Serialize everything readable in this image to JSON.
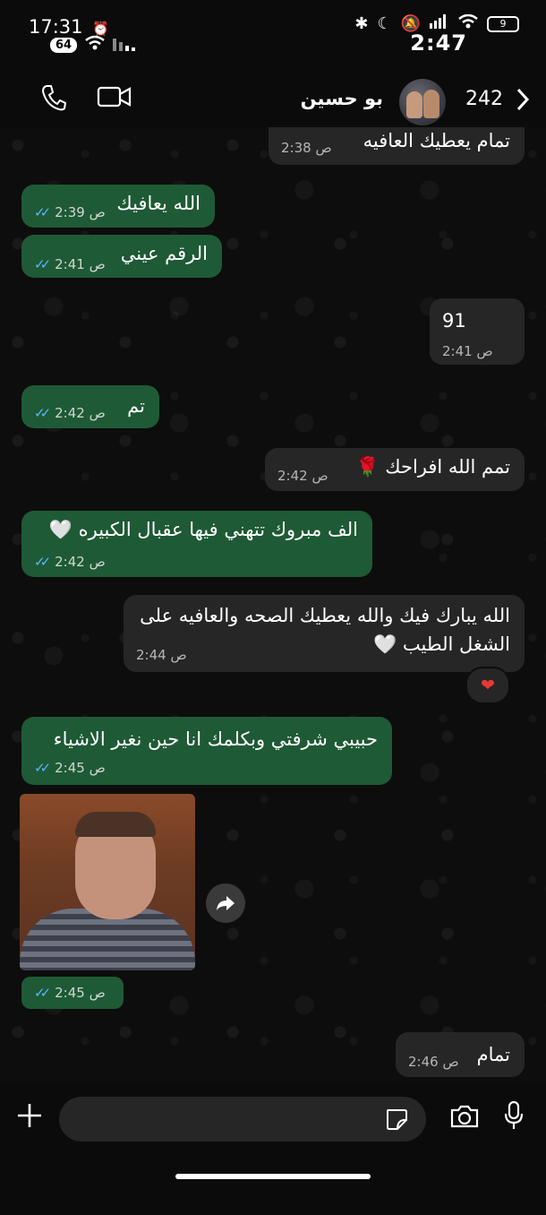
{
  "status_bar": {
    "time_left": "17:31",
    "badge": "64",
    "time_right": "2:47",
    "battery": "9"
  },
  "header": {
    "contact_name": "بو حسين",
    "unread_count": "242"
  },
  "messages": [
    {
      "dir": "in",
      "text": "تمام يعطيك العافيه",
      "time": "2:38 ص"
    },
    {
      "dir": "out",
      "text": "الله يعافيك",
      "time": "2:39 ص"
    },
    {
      "dir": "out",
      "text": "الرقم عيني",
      "time": "2:41 ص"
    },
    {
      "dir": "in",
      "text": "91",
      "time": "2:41 ص"
    },
    {
      "dir": "out",
      "text": "تم",
      "time": "2:42 ص"
    },
    {
      "dir": "in",
      "text": "تمم الله افراحك 🌹",
      "time": "2:42 ص"
    },
    {
      "dir": "out",
      "text": "الف مبروك تتهني فيها عقبال الكبيره 🤍",
      "time": "2:42 ص"
    },
    {
      "dir": "in",
      "line1": "الله يبارك فيك والله يعطيك الصحه والعافيه على",
      "line2": "الشغل الطيب 🤍",
      "time": "2:44 ص"
    },
    {
      "dir": "out",
      "text": "حبيبي شرفتي وبكلمك انا حين نغير الاشياء",
      "time": "2:45 ص"
    },
    {
      "dir": "out",
      "type": "image",
      "time": "2:45 ص"
    },
    {
      "dir": "in",
      "text": "تمام",
      "time": "2:46 ص"
    }
  ],
  "reaction": "❤",
  "colors": {
    "outgoing_bubble": "#1e5a35",
    "incoming_bubble": "#262626",
    "read_tick": "#5eb4ff"
  },
  "icons": [
    "phone-icon",
    "video-icon",
    "back-chevron-icon",
    "plus-icon",
    "sticker-icon",
    "camera-icon",
    "mic-icon",
    "forward-icon"
  ]
}
